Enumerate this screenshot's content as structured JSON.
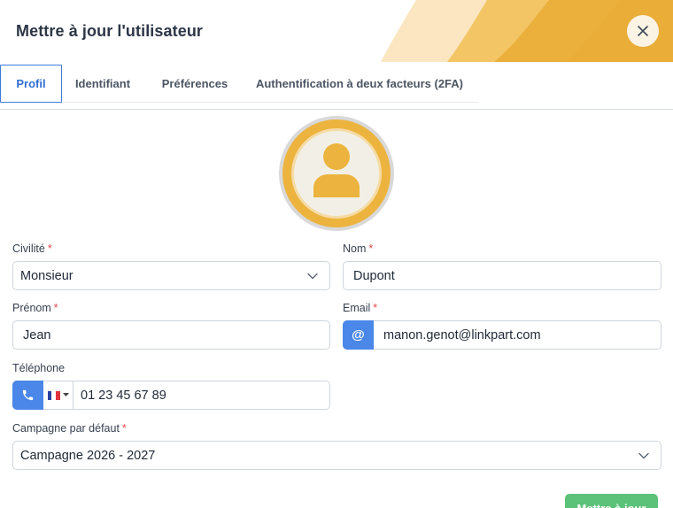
{
  "modal": {
    "title": "Mettre à jour l'utilisateur",
    "tabs": [
      {
        "label": "Profil"
      },
      {
        "label": "Identifiant"
      },
      {
        "label": "Préférences"
      },
      {
        "label": "Authentification à deux facteurs (2FA)"
      }
    ],
    "active_tab": "Profil",
    "colors": {
      "primary": "#3b7cdd",
      "accent": "#ecb43e",
      "success": "#5cc27a",
      "required": "#e24a4a"
    }
  },
  "form": {
    "civilite": {
      "label": "Civilité",
      "value": "Monsieur"
    },
    "nom": {
      "label": "Nom",
      "value": "Dupont"
    },
    "prenom": {
      "label": "Prénom",
      "value": "Jean"
    },
    "email": {
      "label": "Email",
      "prefix": "@",
      "value": "manon.genot@linkpart.com"
    },
    "telephone": {
      "label": "Téléphone",
      "value": "01 23 45 67 89",
      "country_flag": "fr-flag-icon"
    },
    "campagne": {
      "label": "Campagne par défaut",
      "value": "Campagne 2026 - 2027"
    },
    "required_marker": "*"
  },
  "footer": {
    "submit_label": "Mettre à jour"
  },
  "icons": {
    "close": "close-icon",
    "avatar": "user-avatar-icon",
    "phone": "phone-icon",
    "chevron": "chevron-down-icon"
  }
}
